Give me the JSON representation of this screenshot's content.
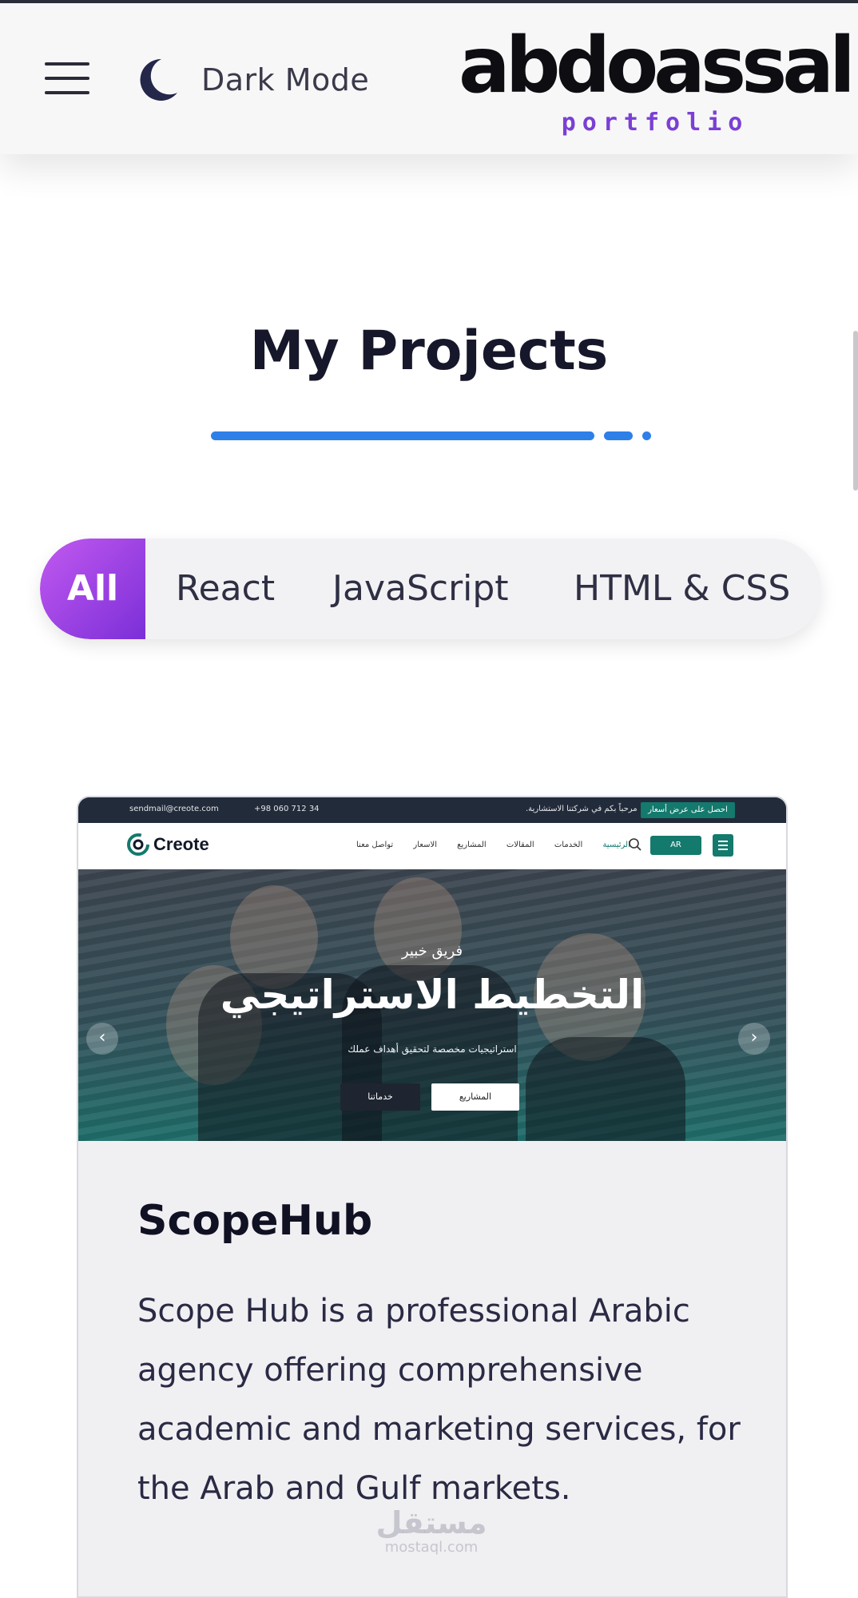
{
  "header": {
    "dark_mode_label": "Dark Mode",
    "logo_text": "abdoassal.",
    "logo_subtext": "portfolio"
  },
  "section": {
    "title": "My Projects"
  },
  "filters": {
    "items": [
      "All",
      "React",
      "JavaScript",
      "HTML & CSS"
    ],
    "active": "All"
  },
  "project": {
    "title": "ScopeHub",
    "description": "Scope Hub is a professional Arabic agency offering comprehensive academic and marketing services, for the Arab and Gulf markets.",
    "screenshot": {
      "topbar_email": "sendmail@creote.com",
      "topbar_phone": "+98 060 712 34",
      "topbar_welcome": "مرحباً بكم في شركتنا الاستشارية.",
      "topbar_offer": "احصل على عرض أسعار",
      "brand": "Creote",
      "nav": [
        "الرئيسية",
        "الخدمات",
        "المقالات",
        "المشاريع",
        "الاسعار",
        "تواصل معنا"
      ],
      "lang": "AR",
      "hero_subtitle": "فريق خبير",
      "hero_title": "التخطيط الاستراتيجي",
      "hero_description": "استراتيجيات مخصصة لتحقيق أهداف عملك",
      "btn_projects": "المشاريع",
      "btn_services": "خدماتنا",
      "arrow_prev": "‹",
      "arrow_next": "›"
    }
  },
  "watermark": {
    "arabic": "مستقل",
    "latin": "mostaql.com"
  },
  "colors": {
    "accent_blue": "#2f7fe8",
    "active_filter_start": "#c259f0",
    "active_filter_end": "#7b2fd8",
    "logo_sub_purple": "#7b3fd4",
    "creote_teal": "#137a6d"
  },
  "icons": {
    "menu": "hamburger-icon",
    "theme": "moon-icon"
  }
}
